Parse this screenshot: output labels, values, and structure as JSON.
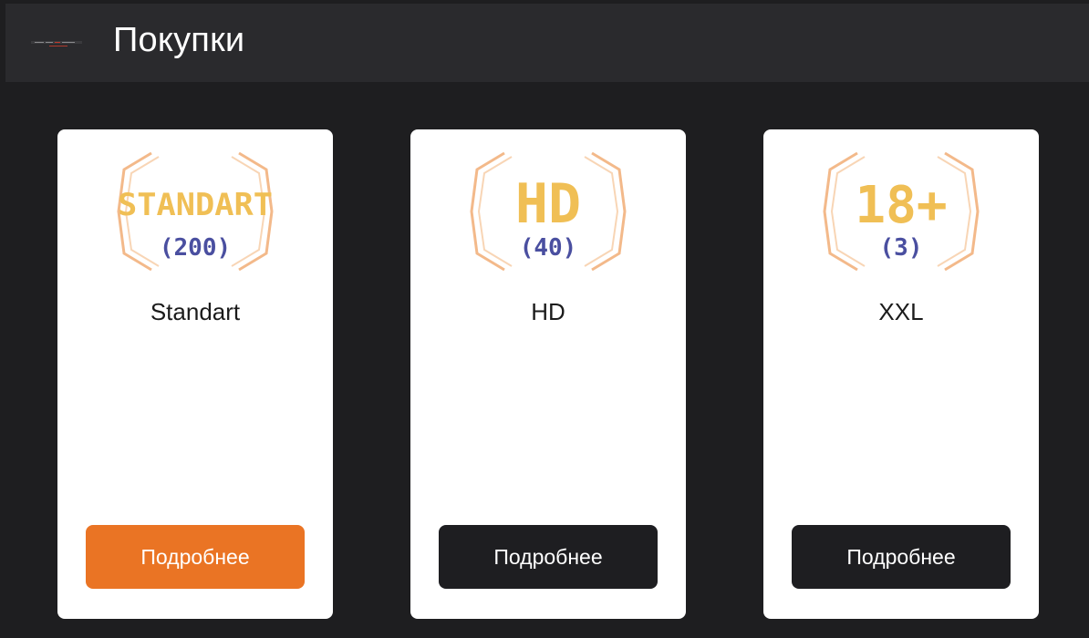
{
  "header": {
    "title": "Покупки",
    "bg_color": "#2a2a2d"
  },
  "colors": {
    "accent": "#ea7424",
    "dark_button": "#1e1e21",
    "badge_gold": "#f0bf55",
    "badge_count": "#4a4fa0",
    "bracket": "#f3b98a"
  },
  "cards": [
    {
      "logo_title": "STANDART",
      "logo_count": "(200)",
      "name": "Standart",
      "button_label": "Подробнее",
      "active": true
    },
    {
      "logo_title": "HD",
      "logo_count": "(40)",
      "name": "HD",
      "button_label": "Подробнее",
      "active": false
    },
    {
      "logo_title": "18+",
      "logo_count": "(3)",
      "name": "XXL",
      "button_label": "Подробнее",
      "active": false
    }
  ]
}
